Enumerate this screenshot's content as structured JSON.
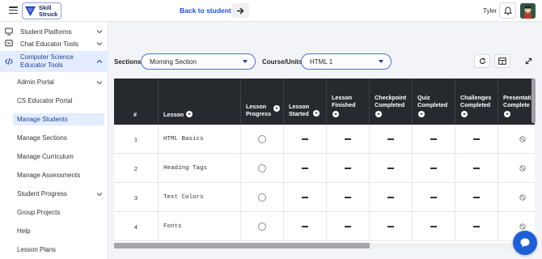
{
  "header": {
    "logo_text_1": "Skill",
    "logo_text_2": "Struck",
    "back_link": "Back to students",
    "username": "Tyler"
  },
  "sidebar": {
    "items": [
      {
        "label": "Student Platforms",
        "icon": "monitor-icon"
      },
      {
        "label": "Chat Educator Tools",
        "icon": "chat-icon"
      },
      {
        "label_1": "Computer Science",
        "label_2": "Educator Tools",
        "icon": "code-icon"
      }
    ],
    "sub_items": [
      {
        "label": "Admin Portal"
      },
      {
        "label": "CS Educator Portal"
      },
      {
        "label": "Manage Students"
      },
      {
        "label": "Manage Sections"
      },
      {
        "label": "Manage Curriculum"
      },
      {
        "label": "Manage Assessments"
      },
      {
        "label": "Student Progress"
      },
      {
        "label": "Group Projects"
      },
      {
        "label": "Help"
      },
      {
        "label": "Lesson Plans"
      }
    ]
  },
  "filters": {
    "sections_label": "Sections",
    "sections_value": "Morning Section",
    "course_label": "Course/Units",
    "course_value": "HTML 1"
  },
  "table": {
    "headers": [
      {
        "label": "#"
      },
      {
        "label": "Lesson"
      },
      {
        "label_1": "Lesson",
        "label_2": "Progress"
      },
      {
        "label_1": "Lesson",
        "label_2": "Started"
      },
      {
        "label_1": "Lesson",
        "label_2": "Finished"
      },
      {
        "label_1": "Checkpoint",
        "label_2": "Completed"
      },
      {
        "label_1": "Quiz",
        "label_2": "Completed"
      },
      {
        "label_1": "Challenges",
        "label_2": "Completed"
      },
      {
        "label_1": "Presentatio",
        "label_2": "Complete"
      }
    ],
    "rows": [
      {
        "num": "1",
        "lesson": "HTML Basics"
      },
      {
        "num": "2",
        "lesson": "Heading Tags"
      },
      {
        "num": "3",
        "lesson": "Text Colors"
      },
      {
        "num": "4",
        "lesson": "Fonts"
      }
    ]
  },
  "colors": {
    "accent": "#1f4fcf",
    "header_dark": "#262a2f",
    "selected_bg": "#e3edff",
    "chat_button": "#1e5fd8"
  }
}
